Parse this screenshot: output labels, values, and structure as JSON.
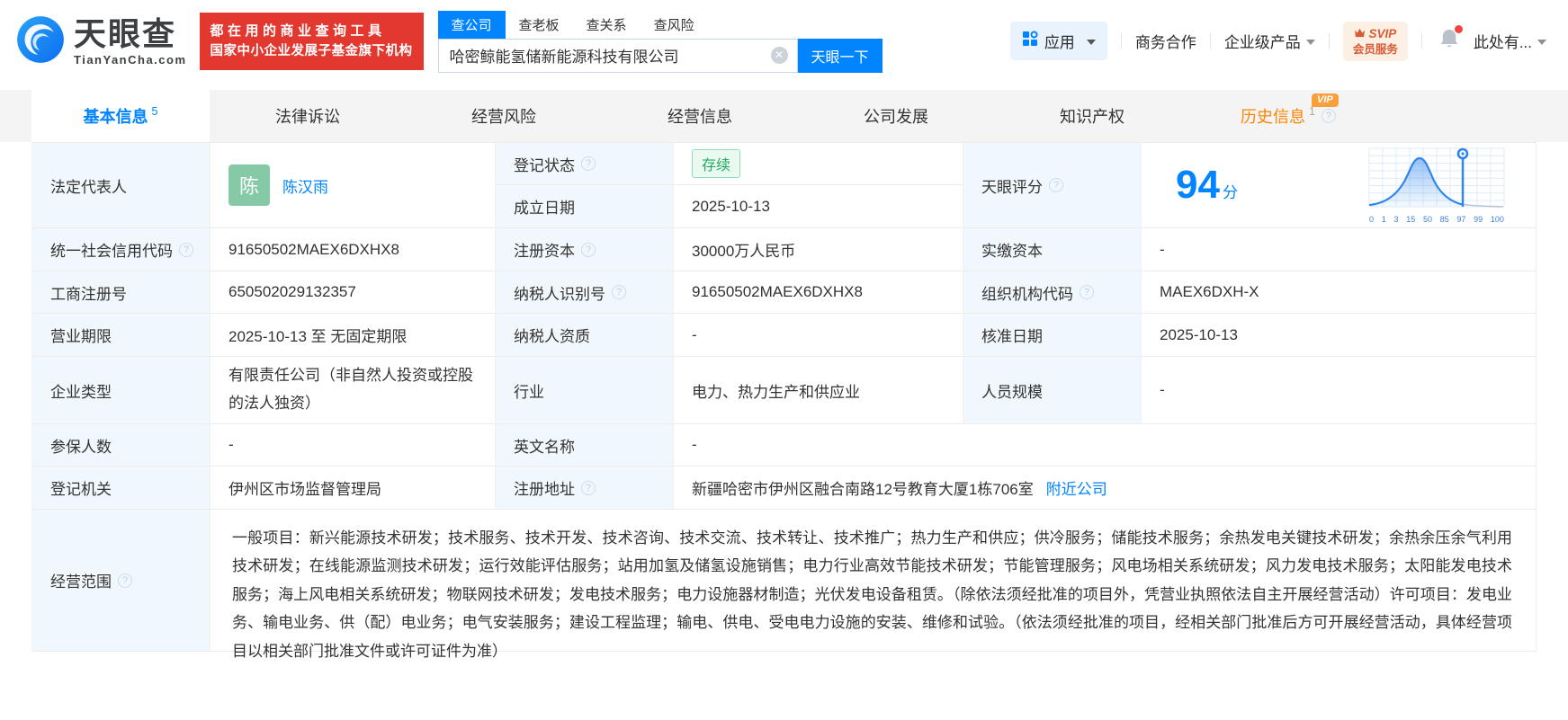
{
  "colors": {
    "brand_blue": "#0084ff",
    "banner_red": "#e23830",
    "status_green": "#21aa5e",
    "history_orange": "#ff8400"
  },
  "header": {
    "logo": {
      "name_cn": "天眼查",
      "domain": "TianYanCha.com"
    },
    "banner": {
      "line1": "都在用的商业查询工具",
      "line2": "国家中小企业发展子基金旗下机构"
    },
    "search": {
      "tabs": [
        {
          "label": "查公司"
        },
        {
          "label": "查老板"
        },
        {
          "label": "查关系"
        },
        {
          "label": "查风险"
        }
      ],
      "value": "哈密鲸能氢储新能源科技有限公司",
      "button": "天眼一下"
    },
    "menu": {
      "apps": "应用",
      "biz_coop": "商务合作",
      "enterprise": "企业级产品",
      "svip_line1": "SVIP",
      "svip_line2": "会员服务",
      "account": "此处有..."
    }
  },
  "nav": {
    "tabs": [
      {
        "label": "基本信息",
        "count": "5"
      },
      {
        "label": "法律诉讼"
      },
      {
        "label": "经营风险"
      },
      {
        "label": "经营信息"
      },
      {
        "label": "公司发展"
      },
      {
        "label": "知识产权"
      },
      {
        "label": "历史信息",
        "count": "1",
        "vip": "VIP"
      }
    ]
  },
  "score_chart": {
    "type": "area",
    "score": "94",
    "unit": "分",
    "ticks": [
      "0",
      "1",
      "3",
      "15",
      "50",
      "85",
      "97",
      "99",
      "100"
    ],
    "marker_value": 94
  },
  "fields": {
    "legal_rep": {
      "label": "法定代表人",
      "avatar": "陈",
      "value": "陈汉雨"
    },
    "reg_status": {
      "label": "登记状态",
      "value": "存续"
    },
    "est_date": {
      "label": "成立日期",
      "value": "2025-10-13"
    },
    "score": {
      "label": "天眼评分"
    },
    "credit_code": {
      "label": "统一社会信用代码",
      "value": "91650502MAEX6DXHX8"
    },
    "reg_capital": {
      "label": "注册资本",
      "value": "30000万人民币"
    },
    "paid_capital": {
      "label": "实缴资本",
      "value": "-"
    },
    "reg_number": {
      "label": "工商注册号",
      "value": "650502029132357"
    },
    "taxpayer_id": {
      "label": "纳税人识别号",
      "value": "91650502MAEX6DXHX8"
    },
    "org_code": {
      "label": "组织机构代码",
      "value": "MAEX6DXH-X"
    },
    "business_term": {
      "label": "营业期限",
      "value": "2025-10-13 至 无固定期限"
    },
    "taxpayer_qualification": {
      "label": "纳税人资质",
      "value": "-"
    },
    "approval_date": {
      "label": "核准日期",
      "value": "2025-10-13"
    },
    "company_type": {
      "label": "企业类型",
      "value": "有限责任公司（非自然人投资或控股的法人独资）"
    },
    "industry": {
      "label": "行业",
      "value": "电力、热力生产和供应业"
    },
    "staff_size": {
      "label": "人员规模",
      "value": "-"
    },
    "insured_count": {
      "label": "参保人数",
      "value": "-"
    },
    "english_name": {
      "label": "英文名称",
      "value": "-"
    },
    "reg_authority": {
      "label": "登记机关",
      "value": "伊州区市场监督管理局"
    },
    "reg_address": {
      "label": "注册地址",
      "value": "新疆哈密市伊州区融合南路12号教育大厦1栋706室",
      "link": "附近公司"
    },
    "business_scope": {
      "label": "经营范围",
      "value": "一般项目：新兴能源技术研发；技术服务、技术开发、技术咨询、技术交流、技术转让、技术推广；热力生产和供应；供冷服务；储能技术服务；余热发电关键技术研发；余热余压余气利用技术研发；在线能源监测技术研发；运行效能评估服务；站用加氢及储氢设施销售；电力行业高效节能技术研发；节能管理服务；风电场相关系统研发；风力发电技术服务；太阳能发电技术服务；海上风电相关系统研发；物联网技术研发；发电技术服务；电力设施器材制造；光伏发电设备租赁。（除依法须经批准的项目外，凭营业执照依法自主开展经营活动）许可项目：发电业务、输电业务、供（配）电业务；电气安装服务；建设工程监理；输电、供电、受电电力设施的安装、维修和试验。（依法须经批准的项目，经相关部门批准后方可开展经营活动，具体经营项目以相关部门批准文件或许可证件为准）"
    }
  }
}
